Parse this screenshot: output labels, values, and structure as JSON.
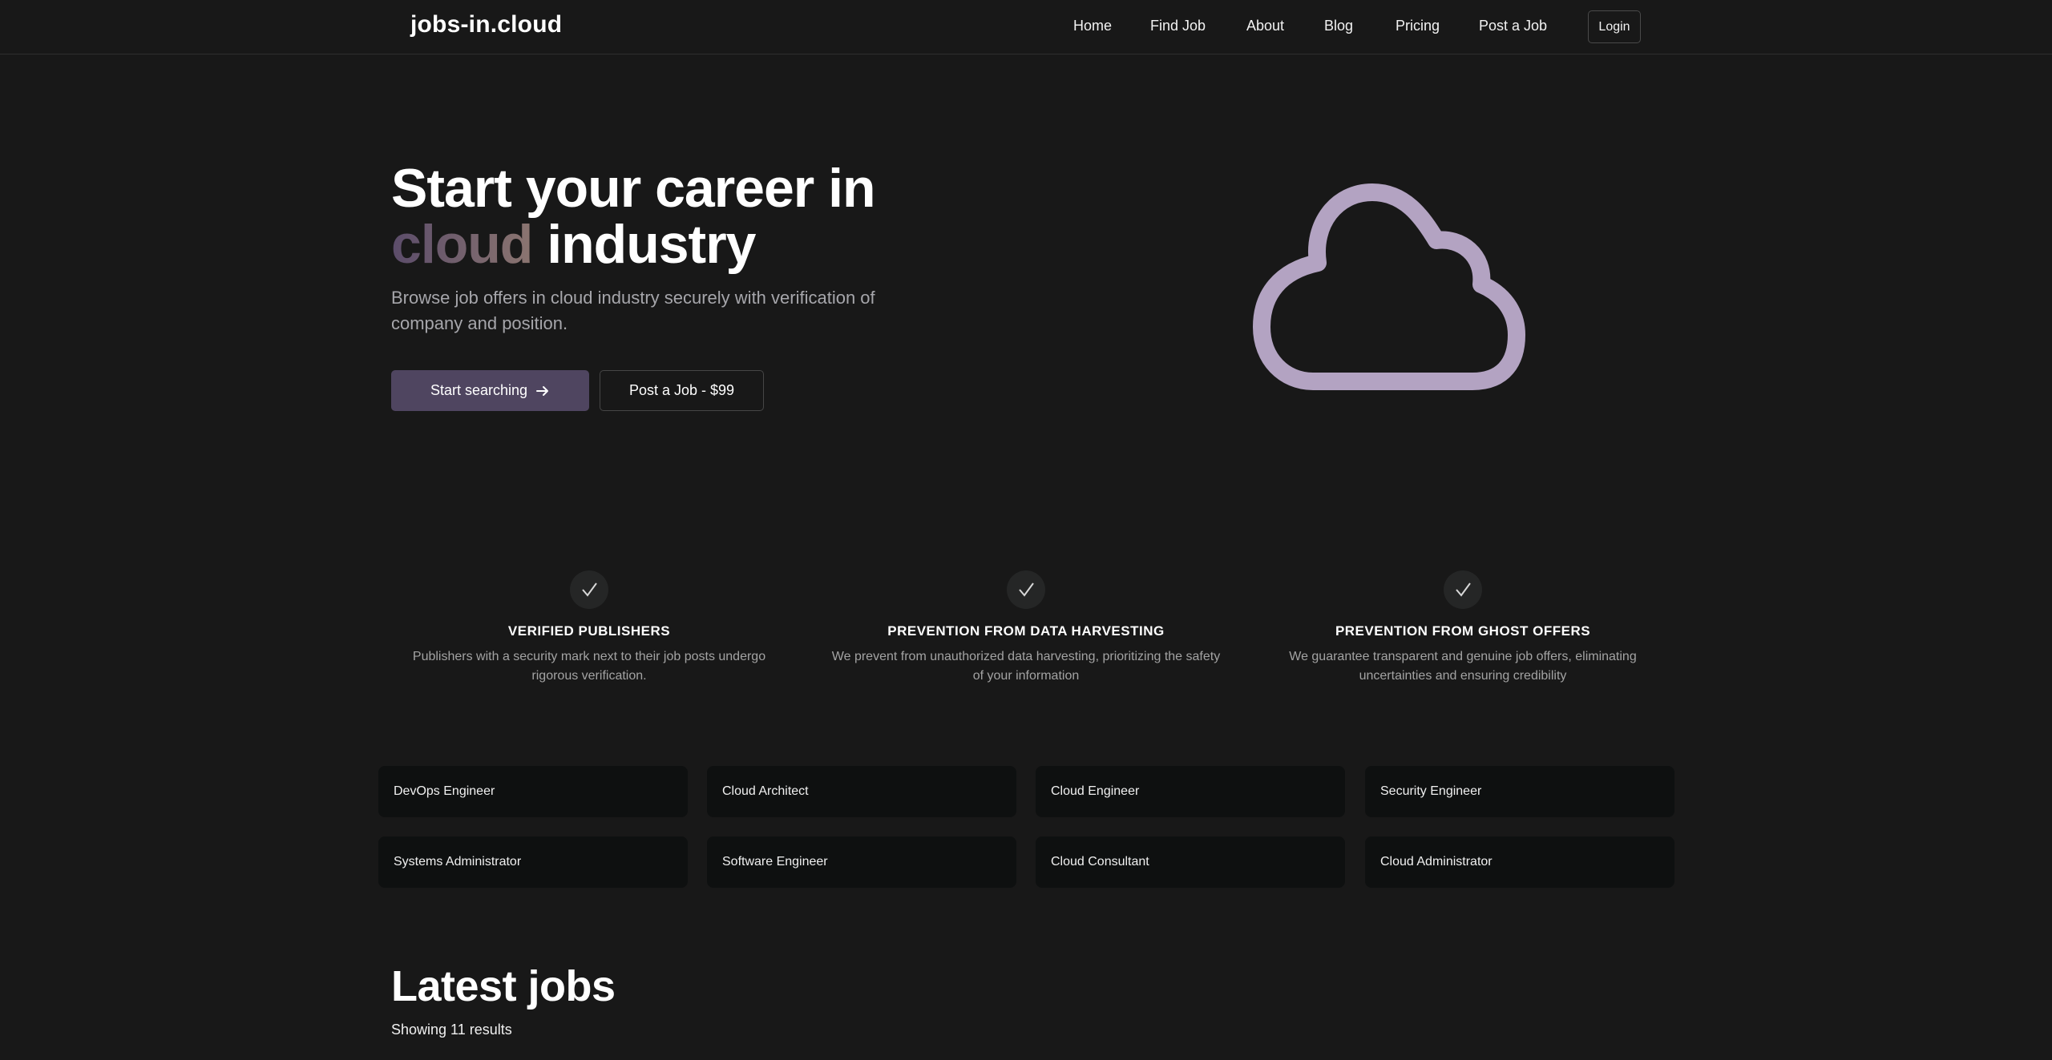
{
  "header": {
    "logo": "jobs-in.cloud",
    "nav": [
      "Home",
      "Find Job",
      "About",
      "Blog",
      "Pricing",
      "Post a Job"
    ],
    "login": "Login"
  },
  "hero": {
    "title_line1": "Start your career in",
    "title_highlight": "cloud",
    "title_rest": "industry",
    "subtitle": "Browse job offers in cloud industry securely with verification of company and position.",
    "primary_button": "Start searching",
    "secondary_button": "Post a Job - $99"
  },
  "features": [
    {
      "title": "VERIFIED PUBLISHERS",
      "description": "Publishers with a security mark next to their job posts undergo rigorous verification."
    },
    {
      "title": "PREVENTION FROM DATA HARVESTING",
      "description": "We prevent from unauthorized data harvesting, prioritizing the safety of your information"
    },
    {
      "title": "PREVENTION FROM GHOST OFFERS",
      "description": "We guarantee transparent and genuine job offers, eliminating uncertainties and ensuring credibility"
    }
  ],
  "categories": [
    "DevOps Engineer",
    "Cloud Architect",
    "Cloud Engineer",
    "Security Engineer",
    "Systems Administrator",
    "Software Engineer",
    "Cloud Consultant",
    "Cloud Administrator"
  ],
  "latest": {
    "title": "Latest jobs",
    "count_text": "Showing 11 results"
  },
  "colors": {
    "background": "#181818",
    "accent": "#4f4560",
    "cloud_icon": "#b3a3c2",
    "card": "#0e1010"
  },
  "icons": [
    "cloud-icon",
    "check-icon",
    "arrow-right-icon"
  ]
}
